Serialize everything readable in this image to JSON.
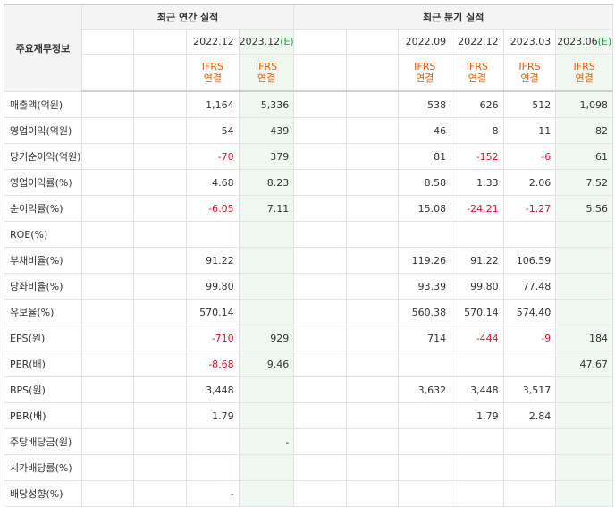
{
  "header": {
    "row_title": "주요재무정보",
    "annual_group": "최근 연간 실적",
    "quarter_group": "최근 분기 실적"
  },
  "annual_columns": [
    {
      "period": "",
      "est_mark": "",
      "estimate": false,
      "ifrs": "",
      "basis": ""
    },
    {
      "period": "",
      "est_mark": "",
      "estimate": false,
      "ifrs": "",
      "basis": ""
    },
    {
      "period": "2022.12",
      "est_mark": "",
      "estimate": false,
      "ifrs": "IFRS",
      "basis": "연결"
    },
    {
      "period": "2023.12",
      "est_mark": "(E)",
      "estimate": true,
      "ifrs": "IFRS",
      "basis": "연결"
    }
  ],
  "quarter_columns": [
    {
      "period": "",
      "est_mark": "",
      "estimate": false,
      "ifrs": "",
      "basis": ""
    },
    {
      "period": "",
      "est_mark": "",
      "estimate": false,
      "ifrs": "",
      "basis": ""
    },
    {
      "period": "2022.09",
      "est_mark": "",
      "estimate": false,
      "ifrs": "IFRS",
      "basis": "연결"
    },
    {
      "period": "2022.12",
      "est_mark": "",
      "estimate": false,
      "ifrs": "IFRS",
      "basis": "연결"
    },
    {
      "period": "2023.03",
      "est_mark": "",
      "estimate": false,
      "ifrs": "IFRS",
      "basis": "연결"
    },
    {
      "period": "2023.06",
      "est_mark": "(E)",
      "estimate": true,
      "ifrs": "IFRS",
      "basis": "연결"
    }
  ],
  "rows": [
    {
      "label": "매출액(억원)",
      "annual": [
        "",
        "",
        "1,164",
        "5,336"
      ],
      "quarter": [
        "",
        "",
        "538",
        "626",
        "512",
        "1,098"
      ]
    },
    {
      "label": "영업이익(억원)",
      "annual": [
        "",
        "",
        "54",
        "439"
      ],
      "quarter": [
        "",
        "",
        "46",
        "8",
        "11",
        "82"
      ]
    },
    {
      "label": "당기순이익(억원)",
      "annual": [
        "",
        "",
        "-70",
        "379"
      ],
      "quarter": [
        "",
        "",
        "81",
        "-152",
        "-6",
        "61"
      ]
    },
    {
      "label": "영업이익률(%)",
      "annual": [
        "",
        "",
        "4.68",
        "8.23"
      ],
      "quarter": [
        "",
        "",
        "8.58",
        "1.33",
        "2.06",
        "7.52"
      ]
    },
    {
      "label": "순이익률(%)",
      "annual": [
        "",
        "",
        "-6.05",
        "7.11"
      ],
      "quarter": [
        "",
        "",
        "15.08",
        "-24.21",
        "-1.27",
        "5.56"
      ]
    },
    {
      "label": "ROE(%)",
      "annual": [
        "",
        "",
        "",
        ""
      ],
      "quarter": [
        "",
        "",
        "",
        "",
        "",
        ""
      ]
    },
    {
      "label": "부채비율(%)",
      "annual": [
        "",
        "",
        "91.22",
        ""
      ],
      "quarter": [
        "",
        "",
        "119.26",
        "91.22",
        "106.59",
        ""
      ]
    },
    {
      "label": "당좌비율(%)",
      "annual": [
        "",
        "",
        "99.80",
        ""
      ],
      "quarter": [
        "",
        "",
        "93.39",
        "99.80",
        "77.48",
        ""
      ]
    },
    {
      "label": "유보율(%)",
      "annual": [
        "",
        "",
        "570.14",
        ""
      ],
      "quarter": [
        "",
        "",
        "560.38",
        "570.14",
        "574.40",
        ""
      ]
    },
    {
      "label": "EPS(원)",
      "annual": [
        "",
        "",
        "-710",
        "929"
      ],
      "quarter": [
        "",
        "",
        "714",
        "-444",
        "-9",
        "184"
      ]
    },
    {
      "label": "PER(배)",
      "annual": [
        "",
        "",
        "-8.68",
        "9.46"
      ],
      "quarter": [
        "",
        "",
        "",
        "",
        "",
        "47.67"
      ]
    },
    {
      "label": "BPS(원)",
      "annual": [
        "",
        "",
        "3,448",
        ""
      ],
      "quarter": [
        "",
        "",
        "3,632",
        "3,448",
        "3,517",
        ""
      ]
    },
    {
      "label": "PBR(배)",
      "annual": [
        "",
        "",
        "1.79",
        ""
      ],
      "quarter": [
        "",
        "",
        "",
        "1.79",
        "2.84",
        ""
      ]
    },
    {
      "label": "주당배당금(원)",
      "annual": [
        "",
        "",
        "",
        "-"
      ],
      "quarter": [
        "",
        "",
        "",
        "",
        "",
        ""
      ]
    },
    {
      "label": "시가배당률(%)",
      "annual": [
        "",
        "",
        "",
        ""
      ],
      "quarter": [
        "",
        "",
        "",
        "",
        "",
        ""
      ]
    },
    {
      "label": "배당성향(%)",
      "annual": [
        "",
        "",
        "-",
        ""
      ],
      "quarter": [
        "",
        "",
        "",
        "",
        "",
        ""
      ]
    }
  ],
  "colors": {
    "negative": "#e0112b",
    "ifrs": "#ea5a00",
    "estimate_bg": "#f1f8f1",
    "estimate_mark": "#27a04a"
  }
}
